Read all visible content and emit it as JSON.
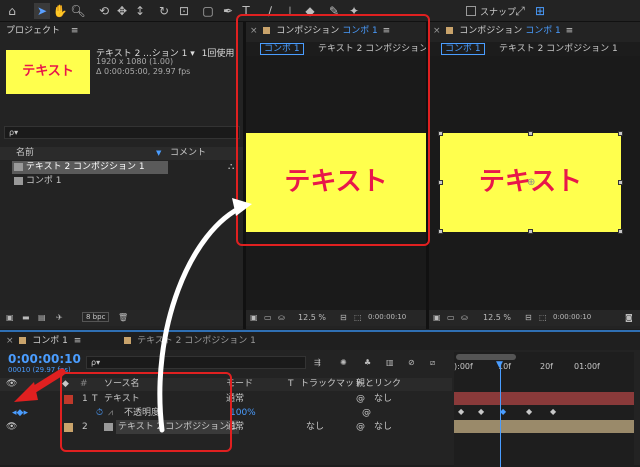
{
  "toolbar": {
    "snap_label": "スナップ",
    "tools": [
      "home-icon",
      "selection-icon",
      "hand-icon",
      "zoom-icon",
      "orbit-icon",
      "pan-icon",
      "dolly-icon",
      "rotate-icon",
      "camera-icon",
      "rect-icon",
      "pen-icon",
      "text-icon",
      "brush-icon",
      "stamp-icon",
      "eraser-icon",
      "roto-icon",
      "pin-icon"
    ]
  },
  "project": {
    "title": "プロジェクト",
    "menu": "≡",
    "thumb_text": "テキスト",
    "item_name": "テキスト 2 ...ション 1 ▾",
    "item_usage": "1回使用",
    "item_size": "1920 x 1080 (1.00)",
    "item_duration": "Δ 0:00:05:00, 29.97 fps",
    "search_placeholder": "ρ▾",
    "col_name": "名前",
    "col_comment": "コメント",
    "items": [
      "テキスト 2 コンポジション 1",
      "コンポ 1"
    ],
    "bpc": "8 bpc"
  },
  "viewer1": {
    "tab_label": "コンポジション",
    "tab_name": "コンポ 1",
    "crumb_active": "コンポ 1",
    "crumb_next": "テキスト 2 コンポジション 1 …",
    "canvas_text": "テキスト",
    "zoom": "12.5 %",
    "time": "0:00:00:10"
  },
  "viewer2": {
    "tab_label": "コンポジション",
    "tab_name": "コンポ 1",
    "crumb_active": "コンポ 1",
    "crumb_next": "テキスト 2 コンポジション 1",
    "canvas_text": "テキスト",
    "zoom": "12.5 %",
    "time": "0:00:00:10"
  },
  "timeline": {
    "tab_active": "コンポ 1",
    "tab_other": "テキスト 2 コンポジション 1",
    "timecode": "0:00:00:10",
    "fps": "00010 (29.97 fps)",
    "col_source": "ソース名",
    "col_mode": "モード",
    "col_t": "T",
    "col_trackmatte": "トラックマット",
    "col_parent": "親とリンク",
    "ruler": [
      "):00f",
      "10f",
      "20f",
      "01:00f"
    ],
    "layers": [
      {
        "num": "1",
        "type": "T",
        "name": "テキスト",
        "mode": "通常",
        "trackmatte": "",
        "parent": "なし"
      },
      {
        "num": "",
        "type": "",
        "name": "不透明度",
        "mode": "100%",
        "trackmatte": "",
        "parent": ""
      },
      {
        "num": "2",
        "type": "",
        "name": "テキスト 2 コンポジション 1",
        "mode": "通常",
        "trackmatte": "なし",
        "parent": "なし"
      }
    ]
  },
  "colors": {
    "accent": "#4a9dff",
    "highlight": "#e02020",
    "canvas": "#ffff4d",
    "text_red": "#e8174a"
  }
}
